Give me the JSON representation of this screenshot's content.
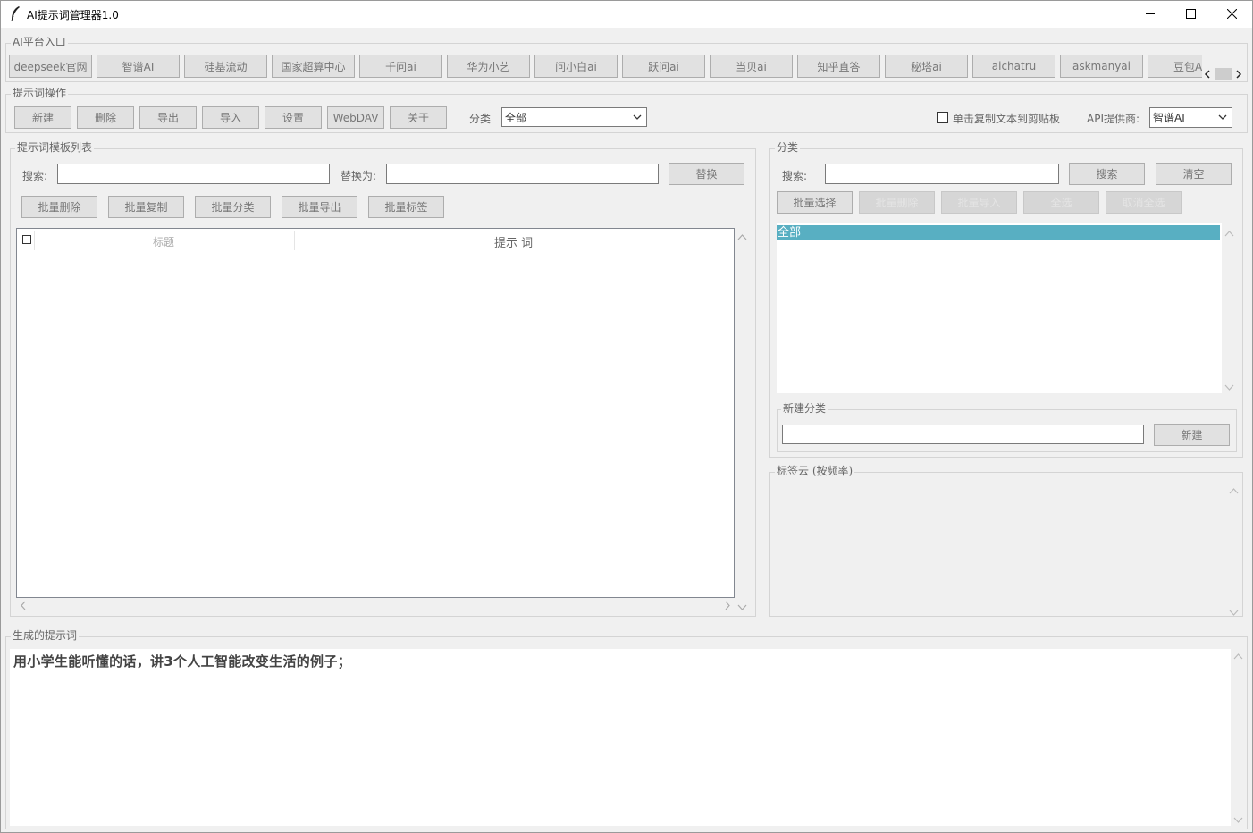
{
  "window": {
    "title": "AI提示词管理器1.0"
  },
  "platforms": {
    "group_label": "AI平台入口",
    "items": [
      "deepseek官网",
      "智谱AI",
      "硅基流动",
      "国家超算中心",
      "千问ai",
      "华为小艺",
      "问小白ai",
      "跃问ai",
      "当贝ai",
      "知乎直答",
      "秘塔ai",
      "aichatru",
      "askmanyai",
      "豆包A"
    ]
  },
  "ops": {
    "group_label": "提示词操作",
    "buttons": [
      "新建",
      "删除",
      "导出",
      "导入",
      "设置",
      "WebDAV",
      "关于"
    ],
    "category_label": "分类",
    "category_value": "全部",
    "copy_checkbox_label": "单击复制文本到剪贴板",
    "copy_checked": false,
    "api_label": "API提供商:",
    "api_value": "智谱AI"
  },
  "template_list": {
    "group_label": "提示词模板列表",
    "search_label": "搜索:",
    "replace_label": "替换为:",
    "replace_button": "替换",
    "batch_buttons": [
      "批量删除",
      "批量复制",
      "批量分类",
      "批量导出",
      "批量标签"
    ],
    "columns": [
      "标题",
      "提示 词"
    ]
  },
  "category_panel": {
    "group_label": "分类",
    "search_label": "搜索:",
    "search_button": "搜索",
    "clear_button": "清空",
    "batch_select_button": "批量选择",
    "disabled_buttons": [
      "批量删除",
      "批量导入",
      "全选",
      "取消全选"
    ],
    "items": [
      "全部"
    ],
    "new_group_label": "新建分类",
    "new_button": "新建"
  },
  "tag_cloud": {
    "group_label": "标签云 (按频率)"
  },
  "generated": {
    "group_label": "生成的提示词",
    "text": "用小学生能听懂的话，讲3个人工智能改变生活的例子；"
  }
}
